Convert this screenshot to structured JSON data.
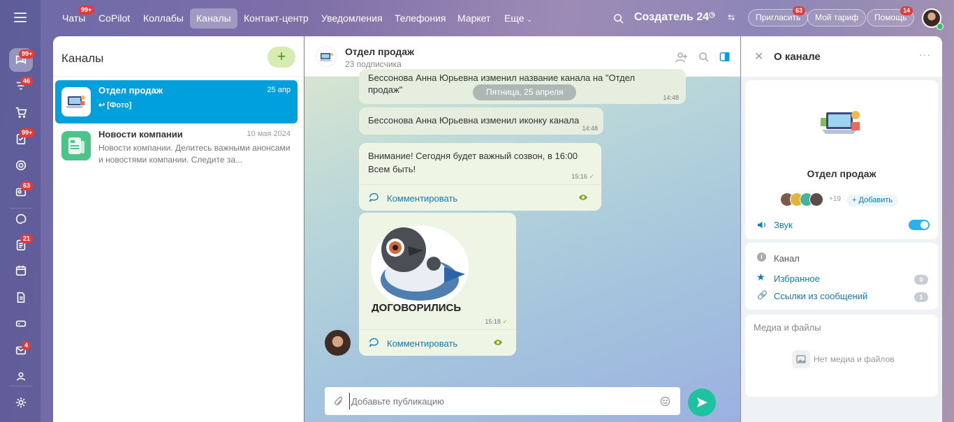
{
  "rail": {
    "badges": [
      "99+",
      "46",
      "99+",
      "63",
      "21",
      "4"
    ]
  },
  "nav": {
    "items": [
      {
        "label": "Чаты",
        "badge": "99+"
      },
      {
        "label": "CoPilot"
      },
      {
        "label": "Коллабы"
      },
      {
        "label": "Каналы"
      },
      {
        "label": "Контакт-центр"
      },
      {
        "label": "Уведомления"
      },
      {
        "label": "Телефония"
      },
      {
        "label": "Маркет"
      },
      {
        "label": "Еще"
      }
    ],
    "brand": "Создатель",
    "brand_num": "24",
    "invite": "Пригласить",
    "invite_badge": "63",
    "tariff": "Мой тариф",
    "help": "Помощь",
    "help_badge": "14"
  },
  "list": {
    "title": "Каналы",
    "add_label": "+",
    "channels": [
      {
        "name": "Отдел продаж",
        "date": "25 апр",
        "preview": "[Фото]"
      },
      {
        "name": "Новости компании",
        "date": "10 мая 2024",
        "preview": "Новости компании. Делитесь важными анонсами и новостями компании. Следите за..."
      }
    ]
  },
  "chat": {
    "title": "Отдел продаж",
    "subtitle": "23 подписчика",
    "date_pill": "Пятница, 25 апреля",
    "messages": [
      {
        "text": "Бессонова Анна Юрьевна изменил название канала на \"Отдел продаж\"",
        "time": "14:48"
      },
      {
        "text": "Бессонова Анна Юрьевна изменил иконку канала",
        "time": "14:48"
      },
      {
        "text_line1": "Внимание! Сегодня будет важный созвон, в 16:00",
        "text_line2": "Всем быть!",
        "time": "15:16",
        "comment": "Комментировать"
      },
      {
        "sticker_caption": "ДОГОВОРИЛИСЬ",
        "time": "15:18",
        "comment": "Комментировать"
      }
    ],
    "composer_placeholder": "Добавьте публикацию"
  },
  "info": {
    "title": "О канале",
    "channel_name": "Отдел продаж",
    "members_more": "+19",
    "add_label": "Добавить",
    "sound_label": "Звук",
    "section_channel": "Канал",
    "favorites": "Избранное",
    "favorites_count": "0",
    "links": "Ссылки из сообщений",
    "links_count": "1",
    "media_title": "Медиа и файлы",
    "no_media": "Нет медиа и файлов"
  },
  "colors": {
    "accent": "#00a0dd",
    "send": "#1fc29f",
    "link": "#0f7bb7",
    "badge": "#e03c3c"
  }
}
